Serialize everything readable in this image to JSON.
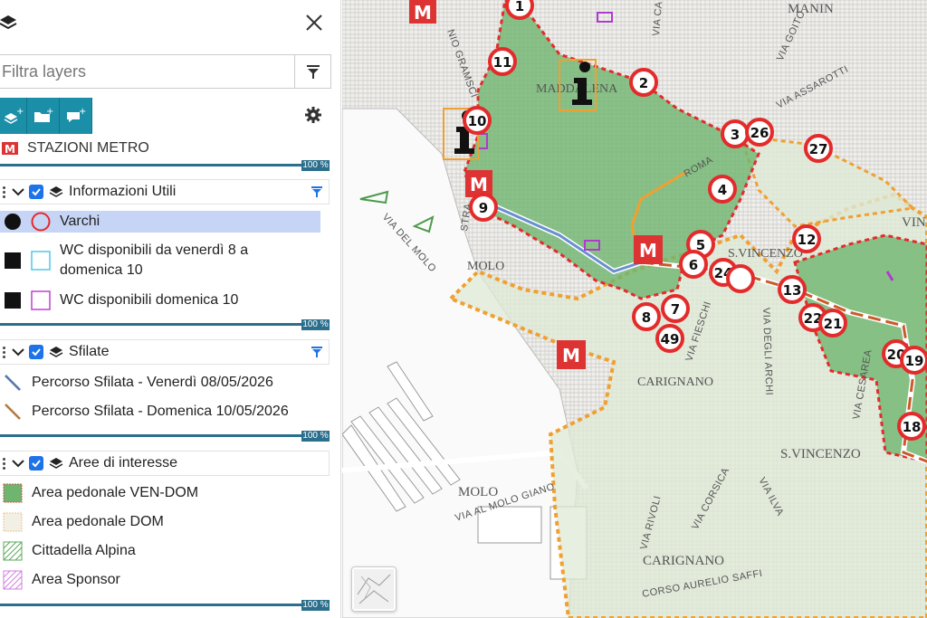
{
  "panel": {
    "filter_placeholder": "Filtra layers",
    "metro_layer_label": "STAZIONI METRO",
    "groups": [
      {
        "title": "Informazioni Utili",
        "opacity": "100 %",
        "items": [
          {
            "label": "Varchi",
            "swatch": "red-circle"
          },
          {
            "label": "WC disponibili da venerdì 8 a domenica 10",
            "swatch": "cyan-square"
          },
          {
            "label": "WC disponibili domenica 10",
            "swatch": "magenta-square"
          }
        ]
      },
      {
        "title": "Sfilate",
        "opacity": "100 %",
        "items": [
          {
            "label": "Percorso Sfilata - Venerdì 08/05/2026",
            "swatch": "blue-line"
          },
          {
            "label": "Percorso Sfilata - Domenica 10/05/2026",
            "swatch": "orange-line"
          }
        ]
      },
      {
        "title": "Aree di interesse",
        "opacity": "100 %",
        "items": [
          {
            "label": "Area pedonale VEN-DOM",
            "swatch": "green-fill"
          },
          {
            "label": "Area pedonale DOM",
            "swatch": "beige-fill"
          },
          {
            "label": "Cittadella Alpina",
            "swatch": "green-hatch"
          },
          {
            "label": "Area Sponsor",
            "swatch": "magenta-hatch"
          }
        ]
      }
    ],
    "metro_opacity": "100 %",
    "colors": {
      "accent": "#1b8fa8",
      "checkbox": "#1e73e8",
      "selection": "#c6d4f5",
      "gate_red": "#e32b2b",
      "ven_dom_green": "#6fb56f",
      "dom_orange": "#f0a030"
    }
  },
  "map": {
    "place_labels": [
      "MANIN",
      "MADDALENA",
      "MOLO",
      "S.VINCENZO",
      "CARIGNANO",
      "CARIGNANO",
      "S.VINCENZO",
      "MOLO",
      "VIN"
    ],
    "street_labels": [
      "VIA ASSAROTTI",
      "VIA GOITO",
      "VIA DEL MOLO",
      "VIA DEGLI ARCHI",
      "VIA FIESCHI",
      "VIA CESAREA",
      "VIA ILVA",
      "VIA CORSICA",
      "VIA RIVOLI",
      "VIA AL MOLO GIANO",
      "CORSO AURELIO SAFFI",
      "ROMA",
      "VIA CA",
      "STRA",
      "NIO GRAMSCI"
    ],
    "gates": [
      "1",
      "11",
      "2",
      "3",
      "26",
      "27",
      "10",
      "4",
      "9",
      "5",
      "12",
      "6",
      "24",
      "13",
      "8",
      "7",
      "22",
      "21",
      "49",
      "20",
      "19",
      "18"
    ]
  }
}
